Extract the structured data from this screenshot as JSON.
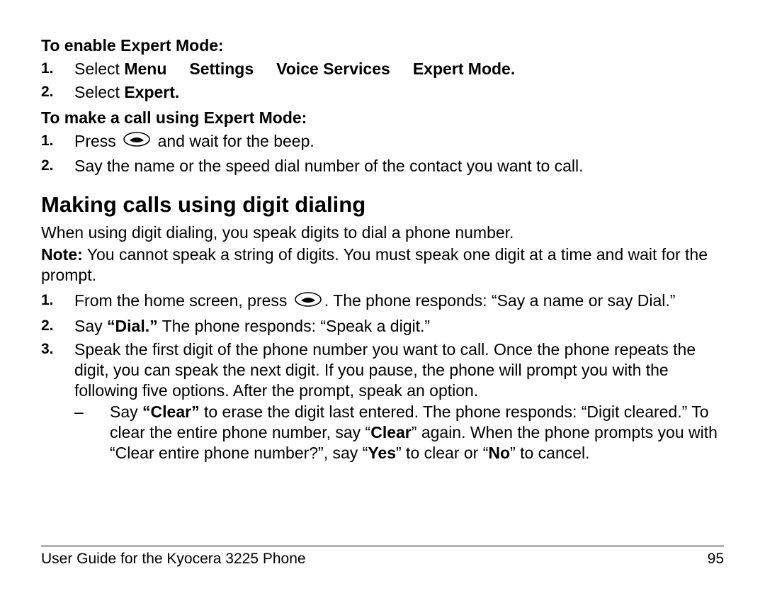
{
  "section1": {
    "heading": "To enable Expert Mode:",
    "items": [
      {
        "num": "1.",
        "before": "Select ",
        "b1": "Menu",
        "b2": "Settings",
        "b3": "Voice Services",
        "b4": "Expert Mode."
      },
      {
        "num": "2.",
        "before": "Select ",
        "b1": "Expert."
      }
    ]
  },
  "section2": {
    "heading": "To make a call using Expert Mode:",
    "items": [
      {
        "num": "1.",
        "before": "Press ",
        "after": " and wait for the beep."
      },
      {
        "num": "2.",
        "text": "Say the name or the speed dial number of the contact you want to call."
      }
    ]
  },
  "heading2": "Making calls using digit dialing",
  "para1": "When using digit dialing, you speak digits to dial a phone number.",
  "noteLabel": "Note:",
  "noteText": " You cannot speak a string of digits. You must speak one digit at a time and wait for the prompt.",
  "section3": {
    "items": [
      {
        "num": "1.",
        "before": "From the home screen, press ",
        "after": ". The phone responds: “Say a name or say Dial.”"
      },
      {
        "num": "2.",
        "before": "Say ",
        "dial": "“Dial.”",
        "after": " The phone responds: “Speak a digit.”"
      },
      {
        "num": "3.",
        "text": "Speak the first digit of the phone number you want to call. Once the phone repeats the digit, you can speak the next digit. If you pause, the phone will prompt you with the following five options. After the prompt, speak an option.",
        "sub": [
          {
            "dash": "–",
            "t1": "Say ",
            "b1": "“Clear”",
            "t2": " to erase the digit last entered. The phone responds: “Digit cleared.” To clear the entire phone number, say “",
            "b2": "Clear",
            "t3": "” again. When the phone prompts you with “Clear entire phone number?”, say “",
            "b3": "Yes",
            "t4": "” to clear or “",
            "b4": "No",
            "t5": "” to cancel."
          }
        ]
      }
    ]
  },
  "footer": {
    "title": "User Guide for the Kyocera 3225 Phone",
    "page": "95"
  }
}
